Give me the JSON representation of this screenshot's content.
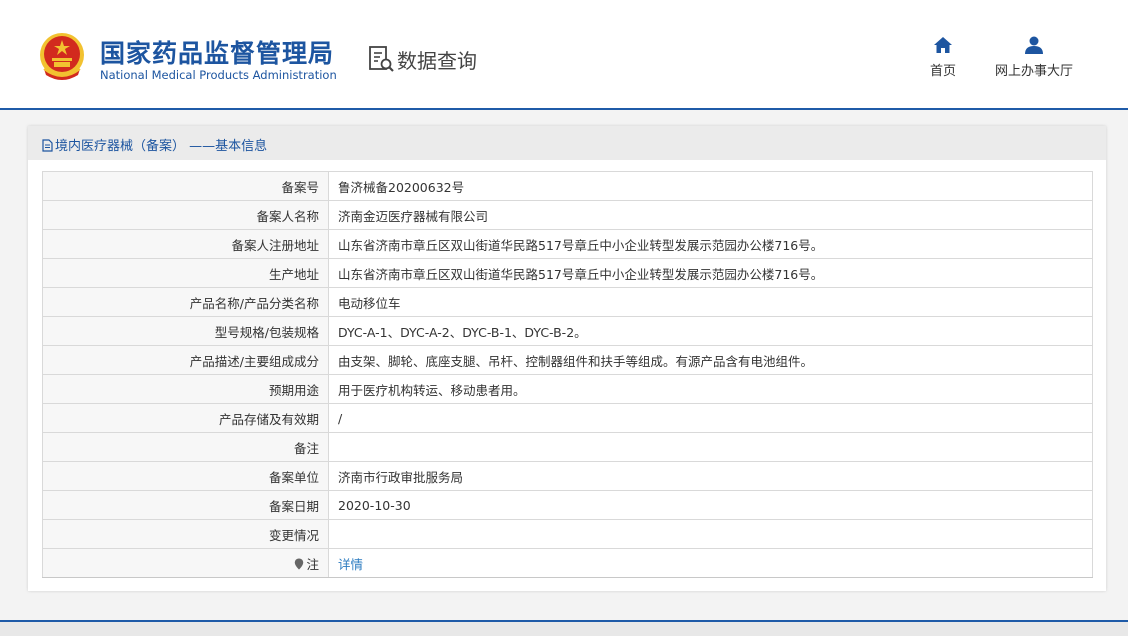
{
  "header": {
    "site_name": "国家药品监督管理局",
    "site_name_en": "National Medical Products Administration",
    "query_label": "数据查询",
    "nav": [
      {
        "label": "首页",
        "icon": "home-icon"
      },
      {
        "label": "网上办事大厅",
        "icon": "user-icon"
      }
    ],
    "colors": {
      "brand": "#1d55a0",
      "emblem_red": "#d22a1e",
      "emblem_gold": "#f2c230"
    }
  },
  "panel": {
    "title": "境内医疗器械（备案） ——基本信息",
    "rows": [
      {
        "label": "备案号",
        "value": "鲁济械备20200632号"
      },
      {
        "label": "备案人名称",
        "value": "济南金迈医疗器械有限公司"
      },
      {
        "label": "备案人注册地址",
        "value": "山东省济南市章丘区双山街道华民路517号章丘中小企业转型发展示范园办公楼716号。"
      },
      {
        "label": "生产地址",
        "value": "山东省济南市章丘区双山街道华民路517号章丘中小企业转型发展示范园办公楼716号。"
      },
      {
        "label": "产品名称/产品分类名称",
        "value": "电动移位车"
      },
      {
        "label": "型号规格/包装规格",
        "value": "DYC-A-1、DYC-A-2、DYC-B-1、DYC-B-2。"
      },
      {
        "label": "产品描述/主要组成成分",
        "value": "由支架、脚轮、底座支腿、吊杆、控制器组件和扶手等组成。有源产品含有电池组件。"
      },
      {
        "label": "预期用途",
        "value": "用于医疗机构转运、移动患者用。"
      },
      {
        "label": "产品存储及有效期",
        "value": "/"
      },
      {
        "label": "备注",
        "value": ""
      },
      {
        "label": "备案单位",
        "value": "济南市行政审批服务局"
      },
      {
        "label": "备案日期",
        "value": "2020-10-30"
      },
      {
        "label": "变更情况",
        "value": ""
      }
    ],
    "note": {
      "label": "注",
      "link": "详情"
    }
  }
}
